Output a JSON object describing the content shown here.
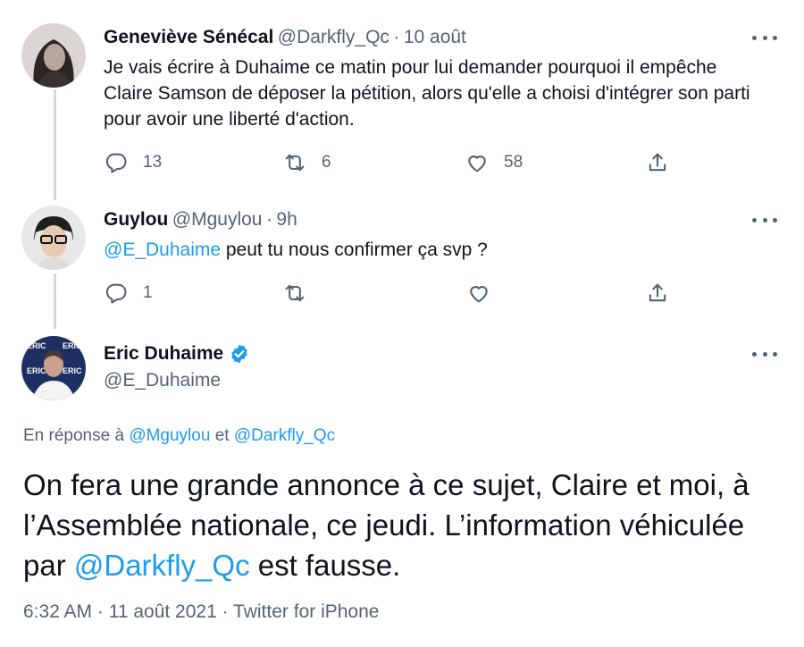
{
  "tweet1": {
    "name": "Geneviève Sénécal",
    "handle": "@Darkfly_Qc",
    "sep": "·",
    "date": "10 août",
    "text": "Je vais écrire à Duhaime ce matin pour lui demander pourquoi il empêche Claire Samson de déposer la pétition, alors qu'elle a choisi d'intégrer son parti pour avoir une liberté d'action.",
    "replies": "13",
    "retweets": "6",
    "likes": "58"
  },
  "tweet2": {
    "name": "Guylou",
    "handle": "@Mguylou",
    "sep": "·",
    "time": "9h",
    "mention": "@E_Duhaime",
    "text": " peut tu nous confirmer ça svp ?",
    "replies": "1"
  },
  "tweet3": {
    "name": "Eric Duhaime",
    "handle": "@E_Duhaime",
    "reply_prefix": "En réponse à ",
    "reply_to_1": "@Mguylou",
    "reply_and": " et ",
    "reply_to_2": "@Darkfly_Qc",
    "text_part1": "On fera une grande annonce à ce sujet, Claire et moi, à l’Assemblée nationale, ce jeudi. L’information véhiculée par ",
    "text_mention": "@Darkfly_Qc",
    "text_part2": " est fausse.",
    "timestamp": "6:32 AM · 11 août 2021 · Twitter for iPhone",
    "avatar_logo_text": "ERIC"
  },
  "colors": {
    "accent": "#1d9bf0",
    "muted": "#536471",
    "text": "#0f1419"
  }
}
